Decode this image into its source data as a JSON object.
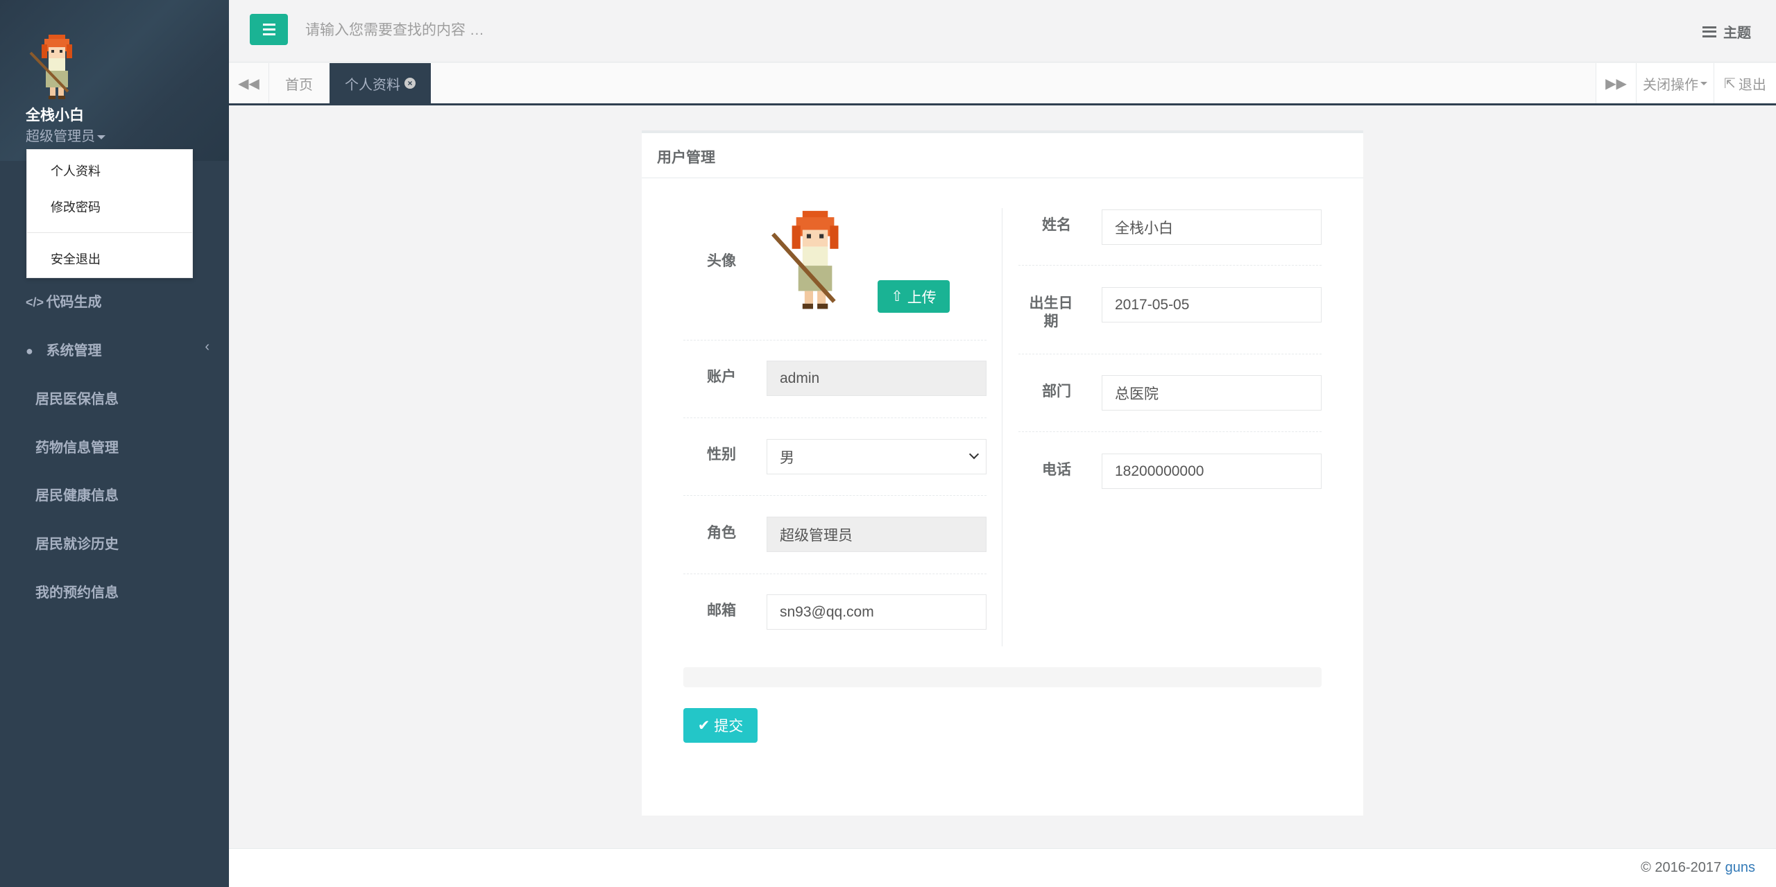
{
  "sidebar": {
    "user_name": "全栈小白",
    "user_role": "超级管理员",
    "dropdown": [
      "个人资料",
      "修改密码",
      "安全退出"
    ],
    "menu": {
      "codegen": "代码生成",
      "system": "系统管理",
      "items": [
        "居民医保信息",
        "药物信息管理",
        "居民健康信息",
        "居民就诊历史",
        "我的预约信息"
      ]
    }
  },
  "header": {
    "search_placeholder": "请输入您需要查找的内容 …",
    "theme_label": "主题"
  },
  "tabs": {
    "items": [
      "首页",
      "个人资料"
    ],
    "close_ops": "关闭操作",
    "logout": "退出"
  },
  "panel": {
    "title": "用户管理",
    "avatar_label": "头像",
    "upload_label": "上传",
    "account_label": "账户",
    "account_value": "admin",
    "gender_label": "性别",
    "gender_value": "男",
    "role_label": "角色",
    "role_value": "超级管理员",
    "email_label": "邮箱",
    "email_value": "sn93@qq.com",
    "name_label": "姓名",
    "name_value": "全栈小白",
    "birth_label": "出生日期",
    "birth_value": "2017-05-05",
    "dept_label": "部门",
    "dept_value": "总医院",
    "phone_label": "电话",
    "phone_value": "18200000000",
    "submit_label": "提交"
  },
  "footer": {
    "copyright": "© 2016-2017",
    "brand": "guns"
  },
  "colors": {
    "sidebar_bg": "#2f4050",
    "primary": "#1ab394",
    "info": "#23c6c8"
  },
  "icons": [
    "menu-icon",
    "theme-icon",
    "backward-icon",
    "forward-icon",
    "signout-icon",
    "code-icon",
    "user-icon",
    "chevron-left-icon",
    "upload-icon",
    "check-icon",
    "close-circle-icon"
  ]
}
